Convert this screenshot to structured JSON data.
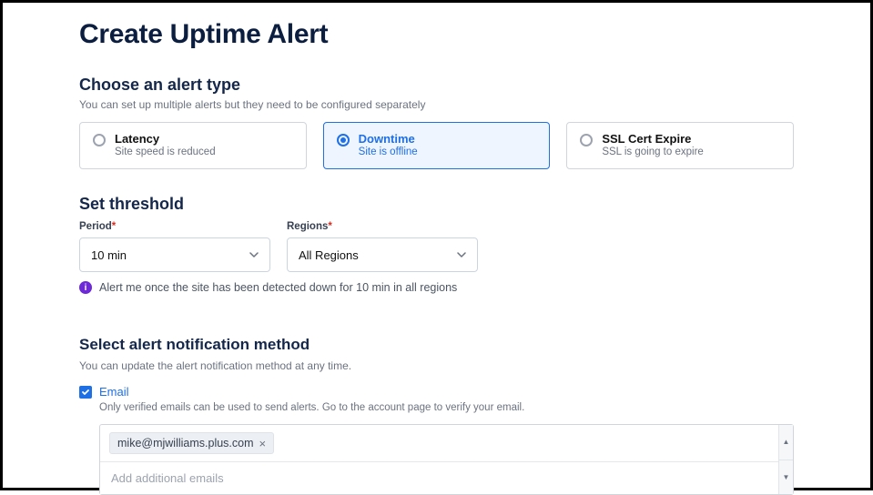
{
  "page": {
    "title": "Create Uptime Alert"
  },
  "alertType": {
    "heading": "Choose an alert type",
    "helper": "You can set up multiple alerts but they need to be configured separately",
    "options": [
      {
        "title": "Latency",
        "sub": "Site speed is reduced",
        "selected": false
      },
      {
        "title": "Downtime",
        "sub": "Site is offline",
        "selected": true
      },
      {
        "title": "SSL Cert Expire",
        "sub": "SSL is going to expire",
        "selected": false
      }
    ]
  },
  "threshold": {
    "heading": "Set threshold",
    "fields": {
      "period": {
        "label": "Period",
        "value": "10 min"
      },
      "regions": {
        "label": "Regions",
        "value": "All Regions"
      }
    },
    "info": "Alert me once the site has been detected down for 10 min in all regions"
  },
  "notification": {
    "heading": "Select alert notification method",
    "helper": "You can update the alert notification method at any time.",
    "email": {
      "label": "Email",
      "checked": true,
      "sub": "Only verified emails can be used to send alerts. Go to the account page to verify your email.",
      "chips": [
        "mike@mjwilliams.plus.com"
      ],
      "placeholder": "Add additional emails"
    }
  }
}
